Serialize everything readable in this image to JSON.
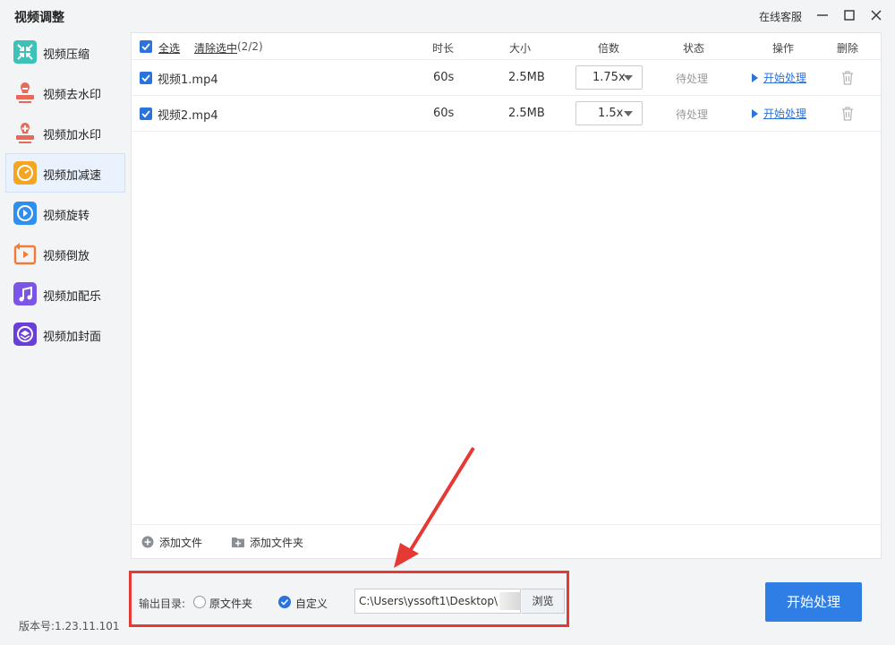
{
  "app": {
    "title": "视频调整",
    "service_label": "在线客服",
    "version": "版本号:1.23.11.101"
  },
  "sidebar": {
    "items": [
      {
        "label": "视频压缩",
        "icon": "compress-icon",
        "color": "#3ec1b7",
        "active": false
      },
      {
        "label": "视频去水印",
        "icon": "remove-watermark-icon",
        "color": "#e8695a",
        "active": false
      },
      {
        "label": "视频加水印",
        "icon": "add-watermark-icon",
        "color": "#e8695a",
        "active": false
      },
      {
        "label": "视频加减速",
        "icon": "speed-icon",
        "color": "#f4a623",
        "active": true
      },
      {
        "label": "视频旋转",
        "icon": "rotate-icon",
        "color": "#2f8ff0",
        "active": false
      },
      {
        "label": "视频倒放",
        "icon": "reverse-icon",
        "color": "#f07c3a",
        "active": false
      },
      {
        "label": "视频加配乐",
        "icon": "music-icon",
        "color": "#7a55e6",
        "active": false
      },
      {
        "label": "视频加封面",
        "icon": "cover-icon",
        "color": "#6a3fd8",
        "active": false
      }
    ]
  },
  "table": {
    "select_all": "全选",
    "clear_selected": "清除选中",
    "selected_count": "(2/2)",
    "headers": {
      "duration": "时长",
      "size": "大小",
      "speed": "倍数",
      "status": "状态",
      "action": "操作",
      "delete": "删除"
    },
    "rows": [
      {
        "name": "视频1.mp4",
        "duration": "60s",
        "size": "2.5MB",
        "speed": "1.75x",
        "status": "待处理",
        "action": "开始处理",
        "checked": true
      },
      {
        "name": "视频2.mp4",
        "duration": "60s",
        "size": "2.5MB",
        "speed": "1.5x",
        "status": "待处理",
        "action": "开始处理",
        "checked": true
      }
    ]
  },
  "footer": {
    "add_file": "添加文件",
    "add_folder": "添加文件夹"
  },
  "output": {
    "label": "输出目录:",
    "option_original": "原文件夹",
    "option_custom": "自定义",
    "selected": "自定义",
    "path": "C:\\Users\\yssoft1\\Desktop\\",
    "browse": "浏览"
  },
  "start_button": "开始处理",
  "colors": {
    "accent": "#2f7ee5",
    "highlight": "#e53935"
  }
}
